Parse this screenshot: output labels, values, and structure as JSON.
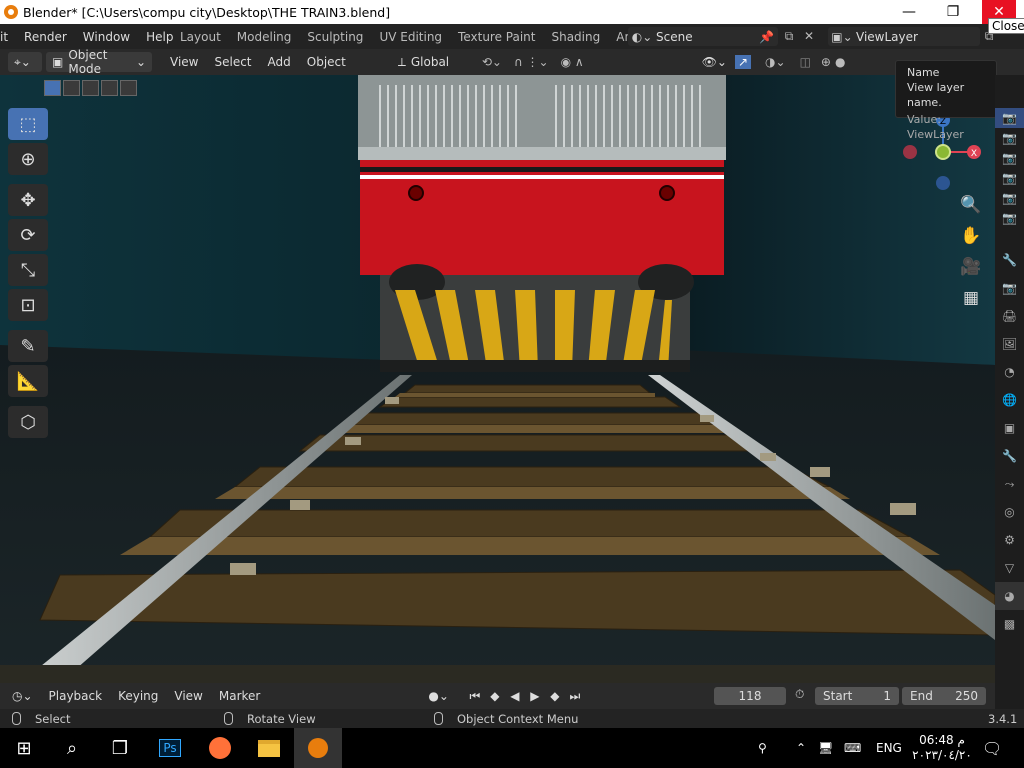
{
  "window": {
    "title": "Blender* [C:\\Users\\compu city\\Desktop\\THE TRAIN3.blend]",
    "minimize": "—",
    "maximize": "❐",
    "close": "✕",
    "close_tooltip": "Close"
  },
  "menubar": {
    "items": [
      "it",
      "Render",
      "Window",
      "Help"
    ]
  },
  "workspaces": [
    "Layout",
    "Modeling",
    "Sculpting",
    "UV Editing",
    "Texture Paint",
    "Shading",
    "Animati"
  ],
  "scene": {
    "label": "Scene"
  },
  "view_layer": {
    "label": "ViewLayer"
  },
  "viewport_header": {
    "mode": "Object Mode",
    "menus": [
      "View",
      "Select",
      "Add",
      "Object"
    ],
    "transform_orientation": "Global"
  },
  "tooltip": {
    "title": "Name",
    "description": "View layer name.",
    "value": "Value: ViewLayer"
  },
  "gizmo": {
    "x": "X",
    "z": "Z"
  },
  "timeline": {
    "menus": [
      "Playback",
      "Keying",
      "View",
      "Marker"
    ],
    "current_frame": "118",
    "start_label": "Start",
    "start": "1",
    "end_label": "End",
    "end": "250"
  },
  "status": {
    "select": "Select",
    "rotate": "Rotate View",
    "context": "Object Context Menu",
    "version": "3.4.1"
  },
  "taskbar": {
    "lang": "ENG",
    "time": "06:48 م",
    "date": "٢٠٢٣/٠٤/٢٠"
  },
  "colors": {
    "accent": "#4772b3",
    "train_red": "#c8141e",
    "gizmo_x": "#e04354",
    "gizmo_y": "#8ab834",
    "gizmo_z": "#3a75c4"
  }
}
